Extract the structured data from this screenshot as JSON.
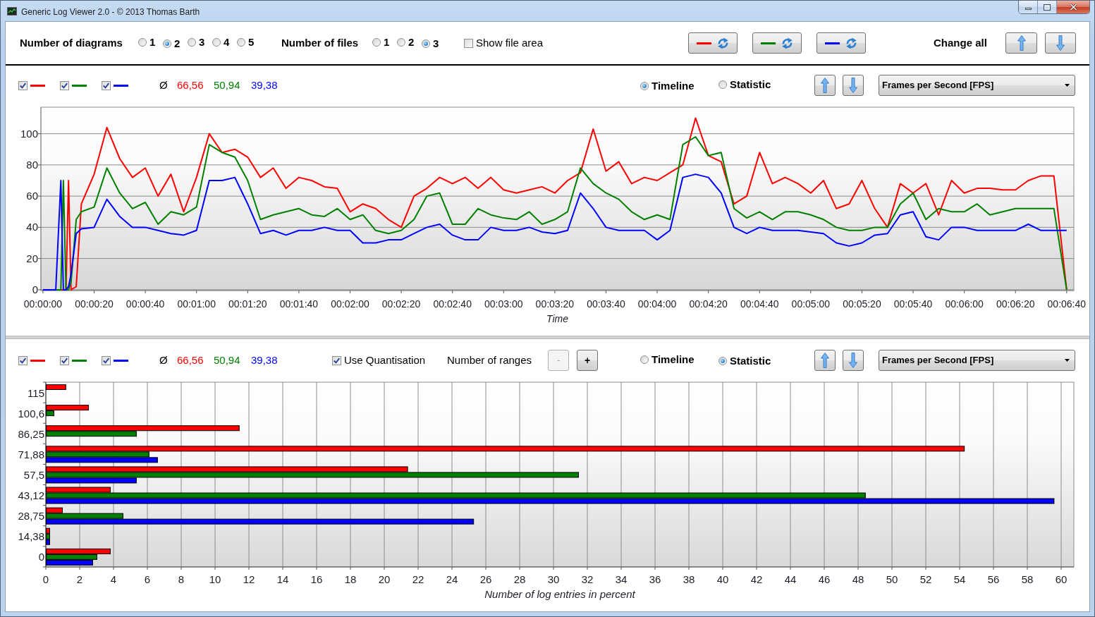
{
  "window": {
    "title": "Generic Log Viewer 2.0 - © 2013 Thomas Barth"
  },
  "toolbar": {
    "diagram_count": {
      "label": "Number of diagrams",
      "options": [
        {
          "label": "1",
          "selected": false
        },
        {
          "label": "2",
          "selected": true
        },
        {
          "label": "3",
          "selected": false
        },
        {
          "label": "4",
          "selected": false
        },
        {
          "label": "5",
          "selected": false
        }
      ]
    },
    "file_count": {
      "label": "Number of files",
      "options": [
        {
          "label": "1",
          "selected": false
        },
        {
          "label": "2",
          "selected": false
        },
        {
          "label": "3",
          "selected": true
        }
      ]
    },
    "show_file_area": {
      "label": "Show file area",
      "checked": false
    },
    "color_buttons": [
      {
        "color": "#ff0000"
      },
      {
        "color": "#008000"
      },
      {
        "color": "#0000ff"
      }
    ],
    "change_all": {
      "label": "Change all"
    }
  },
  "panels": [
    {
      "series_toggles": [
        {
          "checked": true,
          "color": "#ff0000"
        },
        {
          "checked": true,
          "color": "#008000"
        },
        {
          "checked": true,
          "color": "#0000ff"
        }
      ],
      "average_symbol": "Ø",
      "averages": [
        {
          "value": "66,56",
          "color": "#ff0000"
        },
        {
          "value": "50,94",
          "color": "#008000"
        },
        {
          "value": "39,38",
          "color": "#0000ff"
        }
      ],
      "view_modes": [
        {
          "label": "Timeline",
          "selected": true
        },
        {
          "label": "Statistic",
          "selected": false
        }
      ],
      "measure": "Frames per Second [FPS]",
      "chart_data": {
        "type": "line",
        "grid": true,
        "xlabel": "Time",
        "xlim": [
          -0.8,
          402.8
        ],
        "ylim": [
          -0.5,
          117
        ],
        "yticks": [
          0,
          20,
          40,
          60,
          80,
          100
        ],
        "xticks": [
          {
            "value": 0,
            "label": "00:00:00"
          },
          {
            "value": 20,
            "label": "00:00:20"
          },
          {
            "value": 40,
            "label": "00:00:40"
          },
          {
            "value": 60,
            "label": "00:01:00"
          },
          {
            "value": 80,
            "label": "00:01:20"
          },
          {
            "value": 100,
            "label": "00:01:40"
          },
          {
            "value": 120,
            "label": "00:02:00"
          },
          {
            "value": 140,
            "label": "00:02:20"
          },
          {
            "value": 160,
            "label": "00:02:40"
          },
          {
            "value": 180,
            "label": "00:03:00"
          },
          {
            "value": 200,
            "label": "00:03:20"
          },
          {
            "value": 220,
            "label": "00:03:40"
          },
          {
            "value": 240,
            "label": "00:04:00"
          },
          {
            "value": 260,
            "label": "00:04:20"
          },
          {
            "value": 280,
            "label": "00:04:40"
          },
          {
            "value": 300,
            "label": "00:05:00"
          },
          {
            "value": 320,
            "label": "00:05:20"
          },
          {
            "value": 340,
            "label": "00:05:40"
          },
          {
            "value": 360,
            "label": "00:06:00"
          },
          {
            "value": 380,
            "label": "00:06:20"
          },
          {
            "value": 400,
            "label": "00:06:40"
          }
        ],
        "x": [
          0,
          5,
          7,
          8,
          9,
          10,
          11,
          13,
          15,
          20,
          25,
          30,
          35,
          40,
          45,
          50,
          55,
          60,
          65,
          70,
          75,
          80,
          85,
          90,
          95,
          100,
          105,
          110,
          115,
          120,
          125,
          130,
          135,
          140,
          145,
          150,
          155,
          160,
          165,
          170,
          175,
          180,
          185,
          190,
          195,
          200,
          205,
          210,
          215,
          220,
          225,
          230,
          235,
          240,
          245,
          250,
          255,
          260,
          265,
          270,
          275,
          280,
          285,
          290,
          295,
          300,
          305,
          310,
          315,
          320,
          325,
          330,
          335,
          340,
          345,
          350,
          355,
          360,
          365,
          370,
          375,
          380,
          385,
          390,
          395,
          400
        ],
        "series": [
          {
            "color": "#ff0000",
            "values": [
              0,
              0,
              0,
              0,
              0,
              70,
              0,
              2,
              55,
              74,
              104,
              84,
              72,
              78,
              60,
              74,
              50,
              72,
              100,
              88,
              90,
              85,
              72,
              78,
              65,
              72,
              70,
              66,
              65,
              50,
              55,
              52,
              45,
              40,
              60,
              65,
              72,
              68,
              72,
              65,
              72,
              64,
              62,
              64,
              66,
              62,
              70,
              75,
              103,
              76,
              82,
              68,
              72,
              70,
              75,
              80,
              110,
              86,
              82,
              55,
              60,
              88,
              68,
              72,
              68,
              62,
              70,
              52,
              55,
              70,
              52,
              40,
              68,
              62,
              68,
              48,
              70,
              62,
              65,
              65,
              64,
              64,
              70,
              73,
              73,
              0
            ]
          },
          {
            "color": "#008000",
            "values": [
              0,
              0,
              0,
              70,
              0,
              0,
              5,
              45,
              50,
              53,
              78,
              62,
              52,
              56,
              42,
              50,
              48,
              53,
              93,
              88,
              85,
              70,
              45,
              48,
              50,
              52,
              48,
              47,
              52,
              45,
              48,
              38,
              36,
              38,
              45,
              60,
              62,
              42,
              42,
              52,
              48,
              46,
              45,
              50,
              42,
              45,
              50,
              78,
              68,
              62,
              58,
              50,
              45,
              48,
              45,
              93,
              98,
              86,
              88,
              52,
              46,
              50,
              45,
              50,
              50,
              48,
              45,
              40,
              38,
              38,
              40,
              40,
              55,
              62,
              45,
              52,
              50,
              50,
              55,
              48,
              50,
              52,
              52,
              52,
              52,
              0
            ]
          },
          {
            "color": "#0000ff",
            "values": [
              0,
              0,
              70,
              0,
              0,
              2,
              10,
              36,
              39,
              40,
              58,
              47,
              40,
              40,
              38,
              36,
              35,
              38,
              70,
              70,
              72,
              55,
              36,
              38,
              35,
              38,
              38,
              40,
              38,
              38,
              30,
              30,
              32,
              32,
              36,
              40,
              42,
              35,
              32,
              32,
              40,
              38,
              38,
              40,
              37,
              36,
              38,
              62,
              52,
              40,
              38,
              38,
              38,
              32,
              38,
              72,
              74,
              72,
              62,
              40,
              36,
              40,
              38,
              38,
              38,
              37,
              36,
              30,
              28,
              30,
              35,
              36,
              48,
              50,
              34,
              32,
              40,
              40,
              38,
              38,
              38,
              38,
              42,
              38,
              38,
              38
            ]
          }
        ]
      }
    },
    {
      "series_toggles": [
        {
          "checked": true,
          "color": "#ff0000"
        },
        {
          "checked": true,
          "color": "#008000"
        },
        {
          "checked": true,
          "color": "#0000ff"
        }
      ],
      "average_symbol": "Ø",
      "averages": [
        {
          "value": "66,56",
          "color": "#ff0000"
        },
        {
          "value": "50,94",
          "color": "#008000"
        },
        {
          "value": "39,38",
          "color": "#0000ff"
        }
      ],
      "quantisation": {
        "label": "Use Quantisation",
        "checked": true
      },
      "ranges": {
        "label": "Number of ranges",
        "buttons": [
          {
            "label": "-",
            "disabled": true
          },
          {
            "label": "+",
            "disabled": false
          }
        ]
      },
      "view_modes": [
        {
          "label": "Timeline",
          "selected": false
        },
        {
          "label": "Statistic",
          "selected": true
        }
      ],
      "measure": "Frames per Second [FPS]",
      "chart_data": {
        "type": "bar",
        "orientation": "horizontal",
        "grid": true,
        "xlabel": "Number of log entries in percent",
        "xlim": [
          0,
          60.75
        ],
        "xticks": [
          0,
          2,
          4,
          6,
          8,
          10,
          12,
          14,
          16,
          18,
          20,
          22,
          24,
          26,
          28,
          30,
          32,
          34,
          36,
          38,
          40,
          42,
          44,
          46,
          48,
          50,
          52,
          54,
          56,
          58,
          60
        ],
        "categories": [
          "115",
          "100,6",
          "86,25",
          "71,88",
          "57,5",
          "43,12",
          "28,75",
          "14,38",
          "0"
        ],
        "series": [
          {
            "color": "#ff0000",
            "values": [
              1.2,
              2.54,
              11.45,
              54.3,
              21.4,
              3.83,
              1.0,
              0.25,
              3.83
            ]
          },
          {
            "color": "#008000",
            "values": [
              null,
              0.5,
              5.37,
              6.12,
              31.5,
              48.45,
              4.58,
              0.25,
              3.04
            ]
          },
          {
            "color": "#0000ff",
            "values": [
              null,
              null,
              null,
              6.62,
              5.37,
              59.6,
              25.3,
              0.25,
              2.79
            ]
          }
        ]
      }
    }
  ]
}
